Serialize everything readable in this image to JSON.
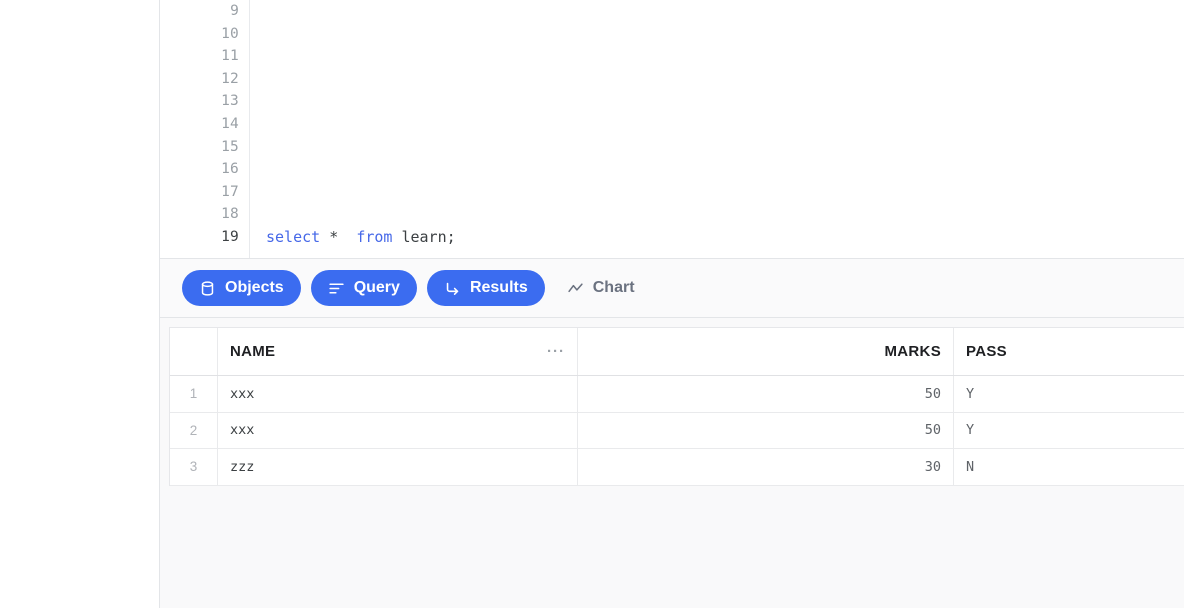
{
  "editor": {
    "lines": [
      {
        "number": "9",
        "code": "",
        "active": false
      },
      {
        "number": "10",
        "code": "",
        "active": false
      },
      {
        "number": "11",
        "code": "",
        "active": false
      },
      {
        "number": "12",
        "code": "",
        "active": false
      },
      {
        "number": "13",
        "code": "",
        "active": false
      },
      {
        "number": "14",
        "code": "",
        "active": false
      },
      {
        "number": "15",
        "code": "",
        "active": false
      },
      {
        "number": "16",
        "code": "",
        "active": false
      },
      {
        "number": "17",
        "code": "",
        "active": false
      },
      {
        "number": "18",
        "code": "",
        "active": false
      },
      {
        "number": "19",
        "code": "select *  from learn;",
        "active": true
      }
    ],
    "sql_tokens": [
      {
        "text": "select",
        "type": "keyword"
      },
      {
        "text": " *  ",
        "type": "plain"
      },
      {
        "text": "from",
        "type": "keyword"
      },
      {
        "text": " learn;",
        "type": "plain"
      }
    ]
  },
  "tabs": [
    {
      "label": "Objects",
      "icon": "database-icon",
      "active": true
    },
    {
      "label": "Query",
      "icon": "align-left-icon",
      "active": true
    },
    {
      "label": "Results",
      "icon": "arrow-turn-down-right-icon",
      "active": true
    },
    {
      "label": "Chart",
      "icon": "line-chart-icon",
      "active": false
    }
  ],
  "results": {
    "column_menu_glyph": "···",
    "columns": [
      "",
      "NAME",
      "MARKS",
      "PASS"
    ],
    "rows": [
      {
        "num": "1",
        "NAME": "xxx",
        "MARKS": "50",
        "PASS": "Y"
      },
      {
        "num": "2",
        "NAME": "xxx",
        "MARKS": "50",
        "PASS": "Y"
      },
      {
        "num": "3",
        "NAME": "zzz",
        "MARKS": "30",
        "PASS": "N"
      }
    ]
  },
  "colors": {
    "accent": "#3b6cf0",
    "keyword": "#4668e8",
    "muted_text": "#6b7280",
    "panel_bg": "#f9f9fa",
    "border": "#e3e5e8"
  }
}
